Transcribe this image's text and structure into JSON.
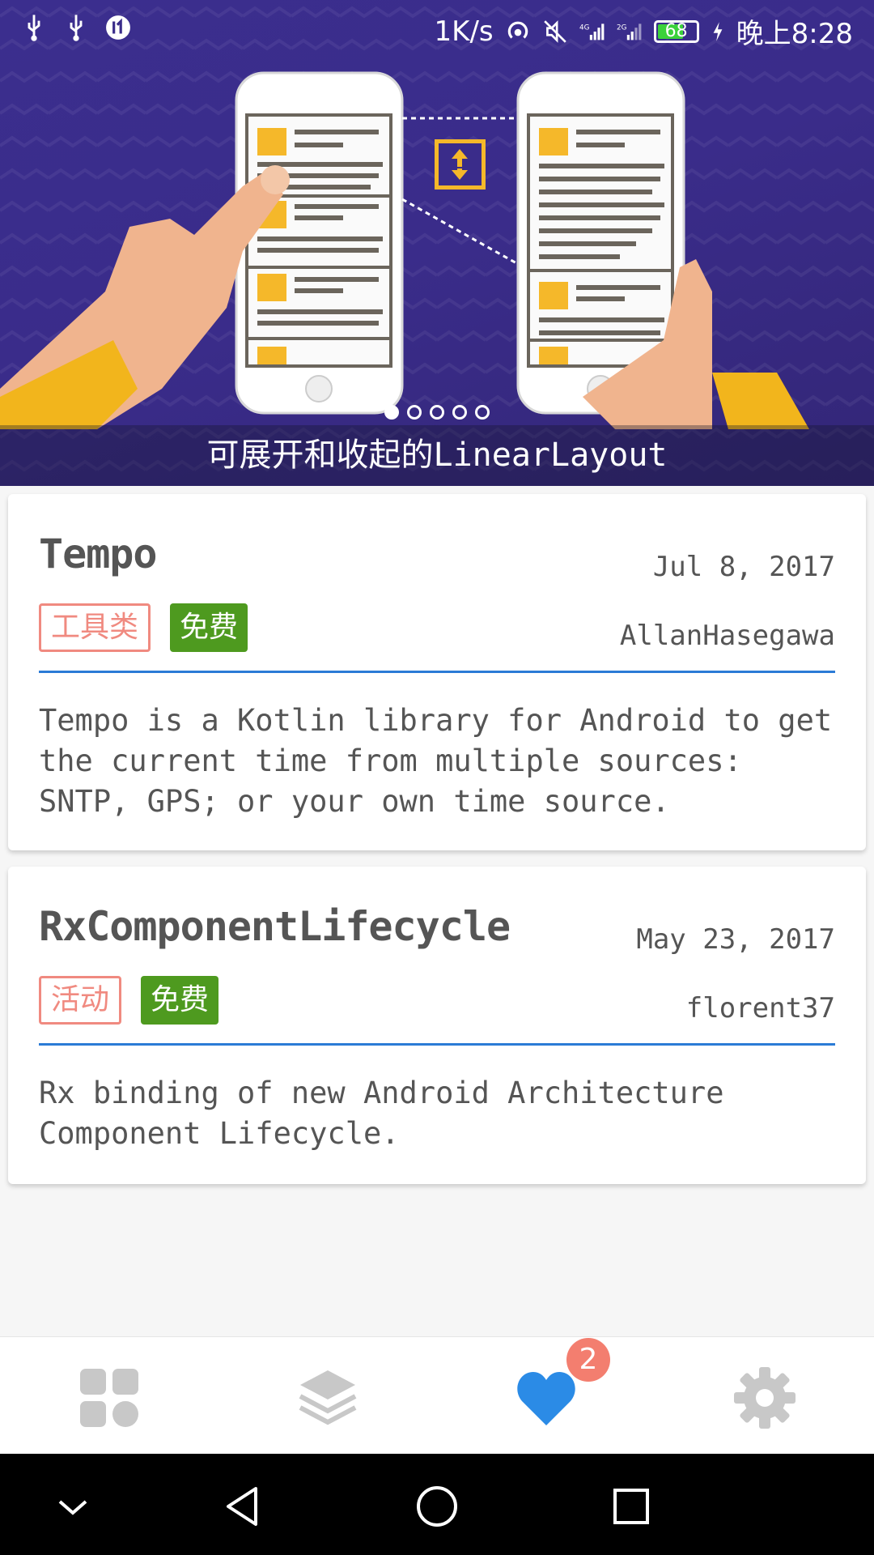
{
  "status_bar": {
    "speed": "1K/s",
    "battery": "68",
    "time": "晚上8:28"
  },
  "banner": {
    "caption": "可展开和收起的LinearLayout",
    "page_count": 5,
    "active_page": 1
  },
  "cards": [
    {
      "title": "Tempo",
      "date": "Jul 8, 2017",
      "category_tag": "工具类",
      "price_tag": "免费",
      "author": "AllanHasegawa",
      "description": "Tempo is a Kotlin library for Android to get the current time from multiple sources: SNTP, GPS; or your own time source."
    },
    {
      "title": "RxComponentLifecycle",
      "date": "May 23, 2017",
      "category_tag": "活动",
      "price_tag": "免费",
      "author": "florent37",
      "description": "Rx binding of new Android Architecture Component Lifecycle."
    }
  ],
  "bottom_nav": {
    "items": [
      "apps-icon",
      "layers-icon",
      "heart-icon",
      "settings-icon"
    ],
    "active": "heart-icon",
    "badge": "2"
  },
  "colors": {
    "accent": "#2b7bd6",
    "tag_category": "#f08a80",
    "tag_free": "#4e9a1f",
    "badge": "#f37e6f"
  }
}
